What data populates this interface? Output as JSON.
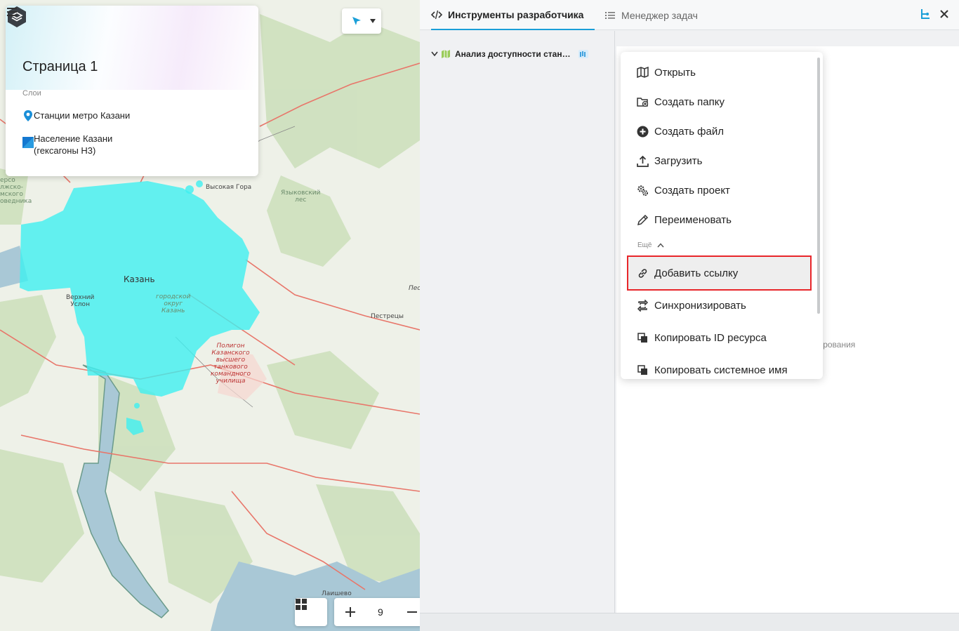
{
  "map": {
    "labels": {
      "kazan": "Казань",
      "vysokaya_gora": "Высокая Гора",
      "yazykovsky": "Языковский\nлес",
      "verkhny_uslon": "Верхний\nУслон",
      "pestretsy": "Пестрецы",
      "laishevo": "Лаишево",
      "gorodskoy": "городской\nокруг\nКазань",
      "poligon": "Полигон\nКазанского\nвысшего\nтанкового\nкомандного\nучилища",
      "pes": "Пес",
      "left_edge": "ерсо\nлжско-\nмского\nоведника"
    },
    "tool": {
      "icon": "pointer-select-icon",
      "dropdown_icon": "caret-down-icon"
    },
    "zoom": {
      "value": "9",
      "grid_icon": "grid-icon",
      "plus_icon": "plus-icon",
      "minus_icon": "minus-icon"
    },
    "colors": {
      "hexagons": "#3ff0f0",
      "roads": "#e8766a",
      "water": "#a9c8d6",
      "forest": "#cfe0c0"
    }
  },
  "layers_card": {
    "page_title": "Страница 1",
    "caption": "Слои",
    "layers": [
      {
        "label": "Станции метро Казани",
        "icon": "map-pin-icon"
      },
      {
        "label": "Население Казани (гексагоны Н3)",
        "icon": "polygon-layer-icon"
      }
    ]
  },
  "panel": {
    "tabs": [
      {
        "label": "Инструменты разработчика",
        "icon": "code-icon",
        "active": true
      },
      {
        "label": "Менеджер задач",
        "icon": "list-icon",
        "active": false
      }
    ],
    "tree": {
      "item_label": "Анализ доступности станций метро",
      "badge_icon": "map-badge-icon"
    },
    "hint_fragment": "тирования",
    "accent": "#1a9fd8"
  },
  "context_menu": {
    "items": [
      {
        "label": "Открыть",
        "icon": "map-open-icon"
      },
      {
        "label": "Создать папку",
        "icon": "folder-add-icon"
      },
      {
        "label": "Создать файл",
        "icon": "plus-circle-icon"
      },
      {
        "label": "Загрузить",
        "icon": "upload-icon"
      },
      {
        "label": "Создать проект",
        "icon": "gears-icon"
      },
      {
        "label": "Переименовать",
        "icon": "pencil-icon"
      }
    ],
    "group_label": "Ещё",
    "more_items": [
      {
        "label": "Добавить ссылку",
        "icon": "link-icon"
      },
      {
        "label": "Синхронизировать",
        "icon": "sync-icon"
      },
      {
        "label": "Копировать ID ресурса",
        "icon": "copy-icon"
      },
      {
        "label": "Копировать системное имя",
        "icon": "copy-icon"
      }
    ],
    "highlight_color": "#e8262a"
  }
}
